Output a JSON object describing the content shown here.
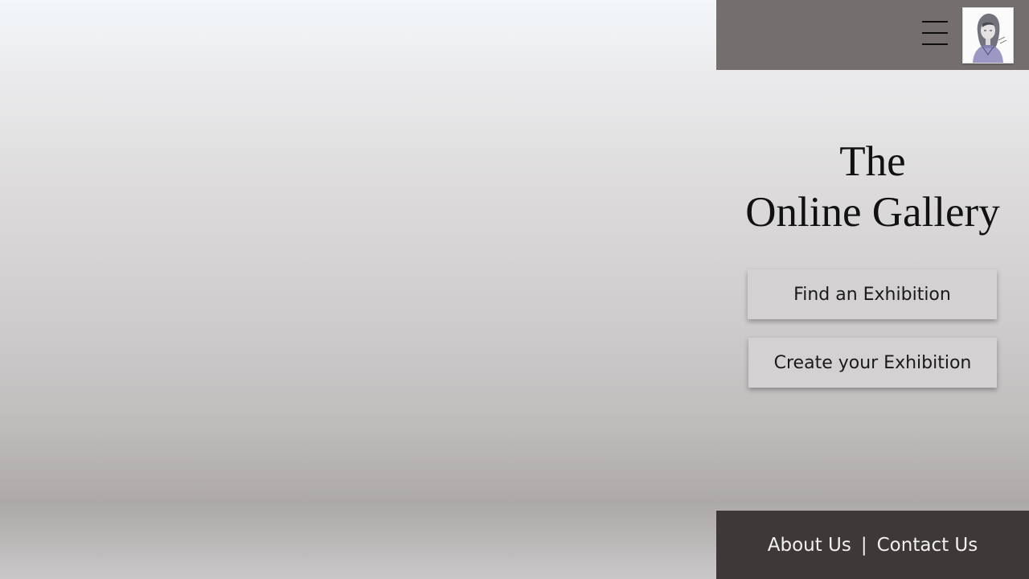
{
  "header": {
    "menu_icon": "hamburger-menu-icon",
    "avatar_icon": "user-avatar-sketch-icon"
  },
  "hero": {
    "title_line1": "The",
    "title_line2": "Online Gallery"
  },
  "actions": {
    "find_label": "Find an Exhibition",
    "create_label": "Create your Exhibition"
  },
  "footer": {
    "about_label": "About Us",
    "separator": "|",
    "contact_label": "Contact Us"
  },
  "colors": {
    "topbar": "#756e6e",
    "footer": "#3e3838",
    "button_bg": "#d3d1d2"
  }
}
